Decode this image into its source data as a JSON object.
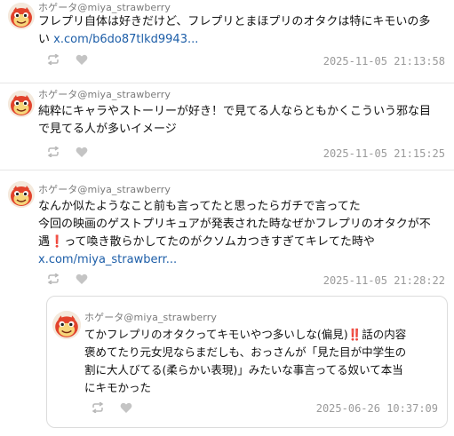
{
  "colors": {
    "link": "#1d5ea8",
    "timestamp": "#9a9a9a",
    "handle": "#7a7a7a",
    "emphasis": "#d21a1a"
  },
  "posts": [
    {
      "handle": "ホゲータ@miya_strawberry",
      "lines": [
        "フレプリ自体は好きだけど、フレプリとまほプリのオタクは特にキモいの多",
        "い"
      ],
      "link": "x.com/b6do87tlkd9943...",
      "timestamp": "2025-11-05 21:13:58",
      "actions": {
        "repost_icon": "repost-icon",
        "like_icon": "heart-icon"
      }
    },
    {
      "handle": "ホゲータ@miya_strawberry",
      "lines": [
        "純粋にキャラやストーリーが好き！で見てる人ならともかくこういう邪な目",
        "で見てる人が多いイメージ"
      ],
      "timestamp": "2025-11-05 21:15:25",
      "actions": {
        "repost_icon": "repost-icon",
        "like_icon": "heart-icon"
      }
    },
    {
      "handle": "ホゲータ@miya_strawberry",
      "lines": [
        "なんか似たようなこと前も言ってたと思ったらガチで言ってた",
        "今回の映画のゲストプリキュアが発表された時なぜかフレプリのオタクが不",
        "遇",
        "って喚き散らかしてたのがクソムカつきすぎてキレてた時や"
      ],
      "emoji_mark": "❗",
      "link": "x.com/miya_strawberr...",
      "timestamp": "2025-11-05 21:28:22",
      "actions": {
        "repost_icon": "repost-icon",
        "like_icon": "heart-icon"
      }
    }
  ],
  "quoted": {
    "handle": "ホゲータ@miya_strawberry",
    "line1_a": "てかフレプリのオタクってキモいやつ多いしな(偏見)",
    "emoji_mark": "‼️",
    "line1_b": "話の内容",
    "lines": [
      "褒めてたり元女児ならまだしも、おっさんが「見た目が中学生の",
      "割に大人びてる(柔らかい表現)」みたいな事言ってる奴いて本当",
      "にキモかった"
    ],
    "timestamp": "2025-06-26 10:37:09",
    "actions": {
      "repost_icon": "repost-icon",
      "like_icon": "heart-icon"
    }
  }
}
